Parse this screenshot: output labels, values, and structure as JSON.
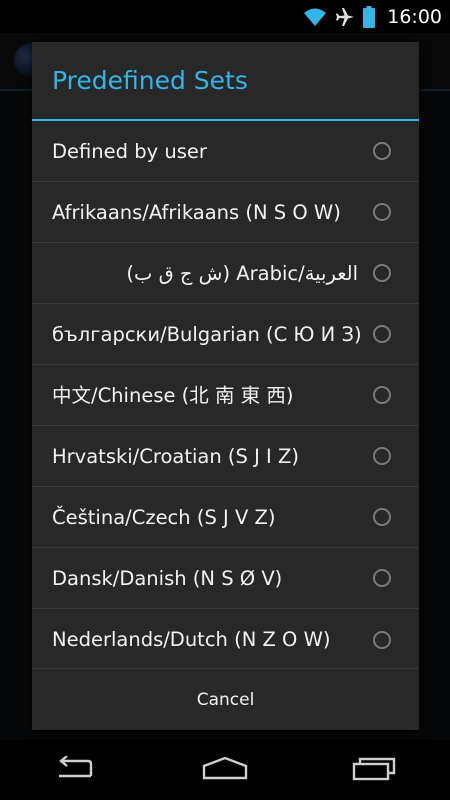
{
  "status_bar": {
    "time": "16:00",
    "icons": [
      "wifi-icon",
      "airplane-icon",
      "battery-icon"
    ]
  },
  "dialog": {
    "title": "Predefined Sets",
    "options": [
      {
        "label": "Defined by user",
        "selected": false
      },
      {
        "label": "Afrikaans/Afrikaans (N S O W)",
        "selected": false
      },
      {
        "label": "العربية/Arabic (ش ج ق ب)",
        "selected": false,
        "rtl": true
      },
      {
        "label": "български/Bulgarian (С Ю И З)",
        "selected": false
      },
      {
        "label": "中文/Chinese (北 南 東 西)",
        "selected": false
      },
      {
        "label": "Hrvatski/Croatian (S J I Z)",
        "selected": false
      },
      {
        "label": "Čeština/Czech (S J V Z)",
        "selected": false
      },
      {
        "label": "Dansk/Danish (N S Ø V)",
        "selected": false
      },
      {
        "label": "Nederlands/Dutch (N Z O W)",
        "selected": false
      }
    ],
    "cancel_label": "Cancel"
  },
  "nav_bar": {
    "buttons": [
      "back-icon",
      "home-icon",
      "recents-icon"
    ]
  },
  "colors": {
    "accent": "#33b5e5",
    "dialog_bg": "#282828",
    "divider": "#3a3a3a"
  }
}
